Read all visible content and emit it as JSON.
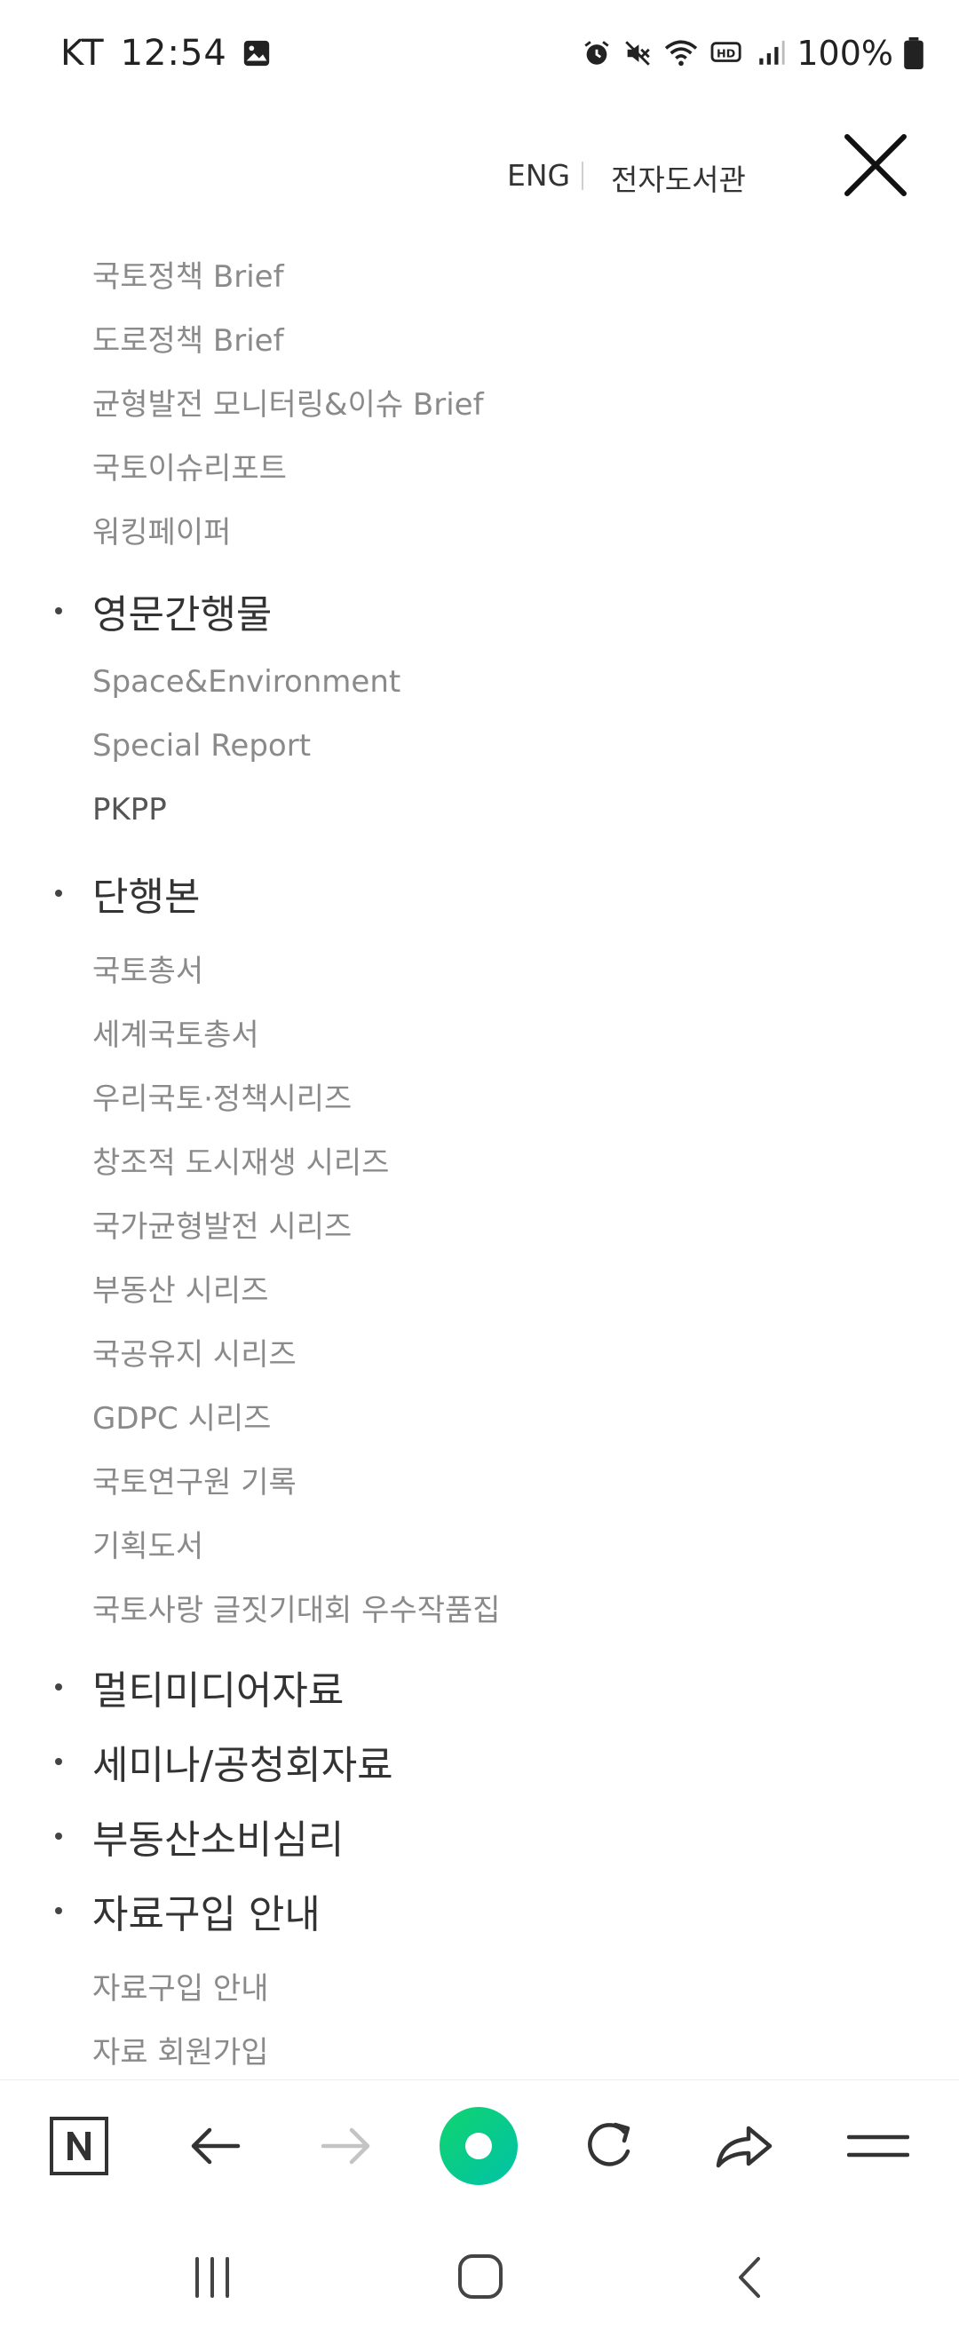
{
  "status_bar": {
    "carrier": "KT",
    "time": "12:54",
    "battery": "100%"
  },
  "header": {
    "lang_link": "ENG",
    "elibrary_link": "전자도서관"
  },
  "menu": {
    "brief_items": [
      "국토정책 Brief",
      "도로정책 Brief",
      "균형발전 모니터링&이슈 Brief",
      "국토이슈리포트",
      "워킹페이퍼"
    ],
    "english_pubs": {
      "title": "영문간행물",
      "items": [
        "Space&Environment",
        "Special Report",
        "PKPP"
      ]
    },
    "books": {
      "title": "단행본",
      "items": [
        "국토총서",
        "세계국토총서",
        "우리국토·정책시리즈",
        "창조적 도시재생 시리즈",
        "국가균형발전 시리즈",
        "부동산 시리즈",
        "국공유지 시리즈",
        "GDPC 시리즈",
        "국토연구원 기록",
        "기획도서",
        "국토사랑 글짓기대회 우수작품집"
      ]
    },
    "multimedia": "멀티미디어자료",
    "seminar": "세미나/공청회자료",
    "realestate": "부동산소비심리",
    "purchase": {
      "title": "자료구입 안내",
      "items": [
        "자료구입 안내",
        "자료 회원가입"
      ]
    }
  },
  "toolbar": {
    "icons": [
      "naver-home-icon",
      "back-arrow-icon",
      "forward-arrow-icon",
      "green-dot-icon",
      "refresh-icon",
      "share-icon",
      "menu-icon"
    ],
    "accent": "#03c75a"
  },
  "nav": {
    "icons": [
      "recent-apps-icon",
      "home-icon",
      "back-icon"
    ]
  }
}
